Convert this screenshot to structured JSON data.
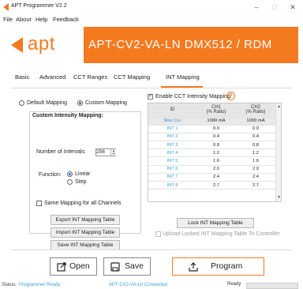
{
  "window": {
    "title": "APT Programmer V2.2",
    "controls": [
      "–",
      "□",
      "✕"
    ]
  },
  "menu": [
    "File",
    "About",
    "Help",
    "Feedback"
  ],
  "brand": {
    "logo": "apt",
    "title": "APT-CV2-VA-LN DMX512 / RDM",
    "accent_color": "#f47a20"
  },
  "tabs": [
    "Basic",
    "Advanced",
    "CCT Ranges",
    "CCT Mapping",
    "INT Mapping"
  ],
  "active_tab": "INT Mapping",
  "mapping_mode": {
    "default_label": "Default Mapping",
    "custom_label": "Custom Mapping",
    "selected": "Custom Mapping"
  },
  "custom_mapping": {
    "title": "Custom Intensity Mapping:",
    "intervals_label": "Number of Intervals:",
    "intervals_value": "256",
    "function_label": "Function:",
    "linear_label": "Linear",
    "step_label": "Step",
    "function_selected": "Linear",
    "same_mapping_label": "Same Mapping for all Channels",
    "export_button": "Export INT Mapping Table",
    "import_button": "Import INT Mapping Table",
    "save_button": "Save INT Mapping Table"
  },
  "cct_option": {
    "enable_label": "Enable CCT Intensity Mapping",
    "help": "?"
  },
  "table": {
    "headers": {
      "id": "ID",
      "ch1": "CH1",
      "ch1_sub": "(% Ratio)",
      "ch2": "CH2",
      "ch2_sub": "(% Ratio)"
    },
    "rows": [
      {
        "id": "Max Cur",
        "ch1": "1000 mA",
        "ch2": "1000 mA"
      },
      {
        "id": "INT 1",
        "ch1": "0.0",
        "ch2": "0.0"
      },
      {
        "id": "INT 2",
        "ch1": "0.4",
        "ch2": "0.4"
      },
      {
        "id": "INT 3",
        "ch1": "0.8",
        "ch2": "0.8"
      },
      {
        "id": "INT 4",
        "ch1": "1.2",
        "ch2": "1.2"
      },
      {
        "id": "INT 5",
        "ch1": "1.6",
        "ch2": "1.6"
      },
      {
        "id": "INT 6",
        "ch1": "2.0",
        "ch2": "2.0"
      },
      {
        "id": "INT 7",
        "ch1": "2.4",
        "ch2": "2.4"
      },
      {
        "id": "INT 8",
        "ch1": "2.7",
        "ch2": "2.7"
      }
    ]
  },
  "lock_button": "Lock INT Mapping Table",
  "upload_locked_label": "Upload Locked INT Mapping Table To Controller",
  "actions": {
    "open": "Open",
    "save": "Save",
    "program": "Program"
  },
  "status": {
    "status_label": "Status:",
    "status_text": "Programmer Ready",
    "device_text": "APT-CV2-VA-Ln Connected",
    "ready_label": "Ready"
  }
}
